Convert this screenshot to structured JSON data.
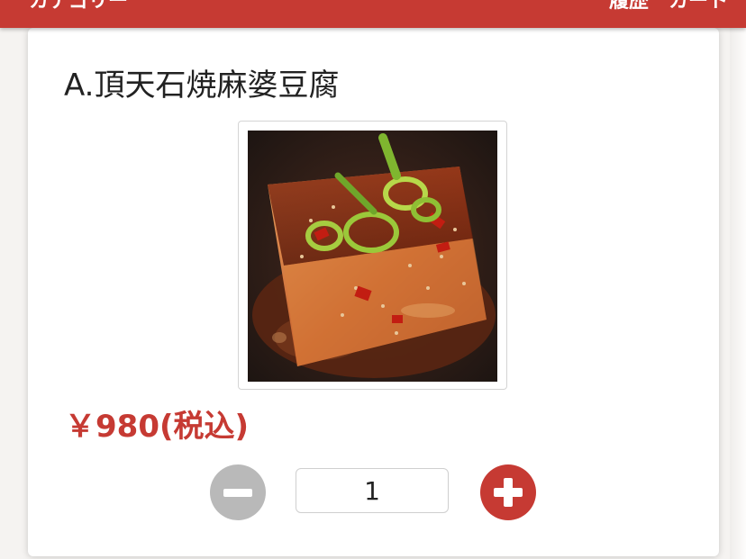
{
  "header": {
    "category_label": "カテゴリー",
    "history_label": "履歴",
    "cart_label": "カート"
  },
  "product": {
    "title": "A.頂天石焼麻婆豆腐",
    "price": "￥980(税込)",
    "image_icon": "mapo-tofu-photo"
  },
  "quantity": {
    "value": "1",
    "minus_icon": "minus-circle-icon",
    "plus_icon": "plus-circle-icon"
  },
  "colors": {
    "brand_red": "#c63a33",
    "minus_gray": "#b9b9b9"
  }
}
